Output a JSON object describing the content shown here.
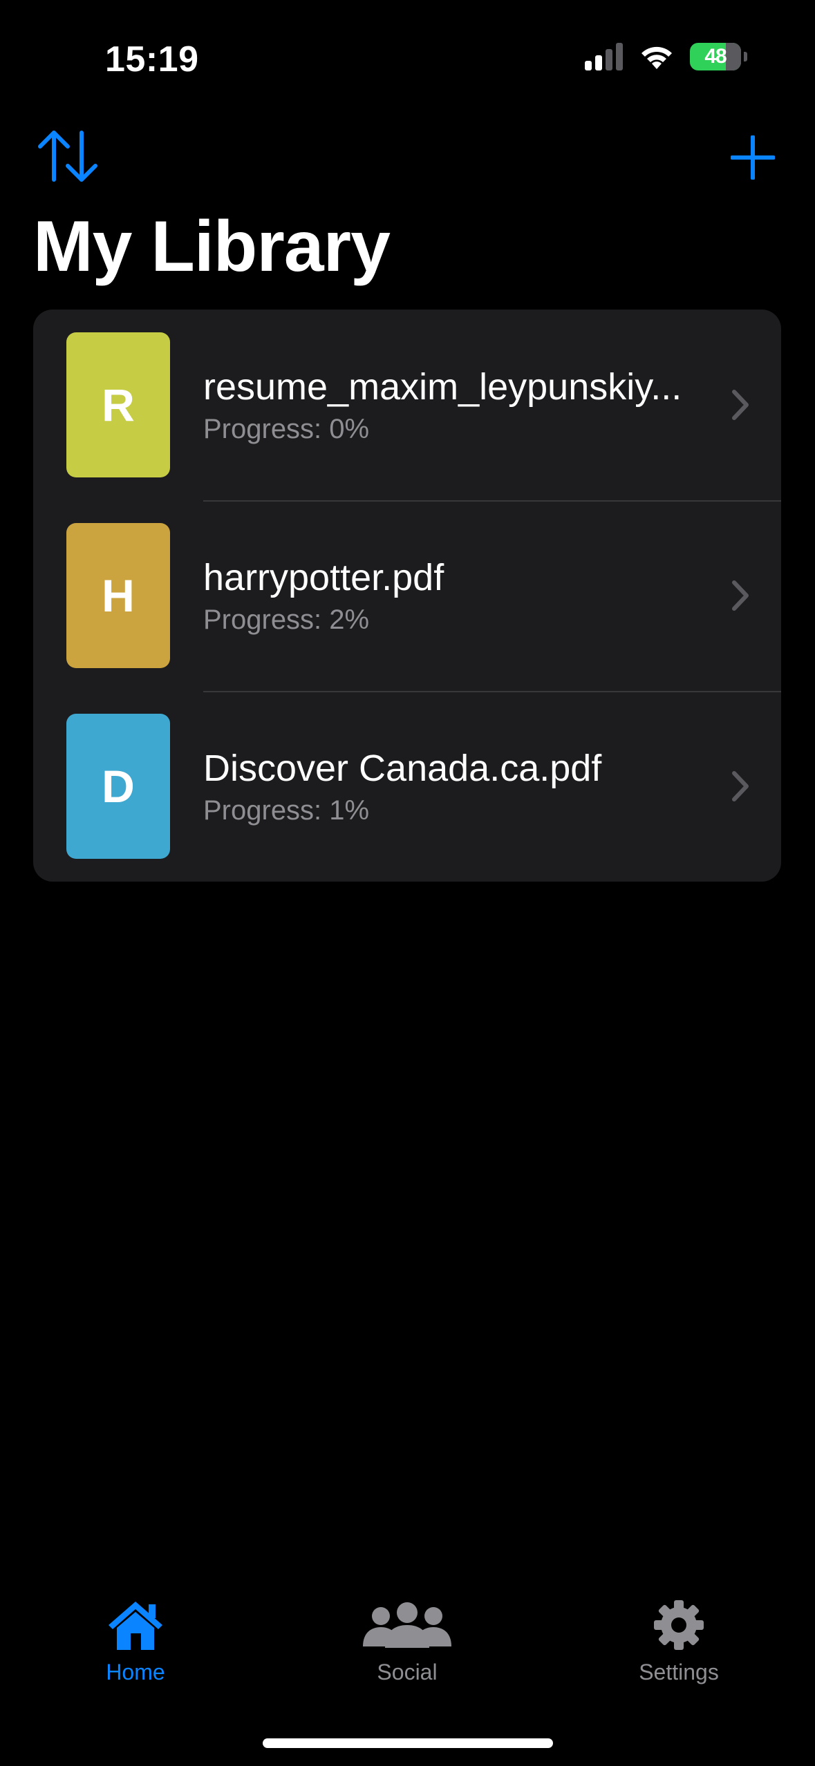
{
  "status_bar": {
    "time": "15:19",
    "battery_percent": "48",
    "icons": [
      "cellular-signal-icon",
      "wifi-icon",
      "battery-charging-icon"
    ]
  },
  "nav": {
    "sort_icon": "sort-arrows-icon",
    "add_icon": "plus-icon",
    "title": "My Library"
  },
  "colors": {
    "accent": "#0a84ff",
    "background": "#000000",
    "card": "#1c1c1e",
    "secondary_text": "#8e8e93"
  },
  "library": {
    "items": [
      {
        "initial": "R",
        "title": "resume_maxim_leypunskiy...",
        "progress": "Progress: 0%",
        "color": "#c6cc44"
      },
      {
        "initial": "H",
        "title": "harrypotter.pdf",
        "progress": "Progress: 2%",
        "color": "#cca43f"
      },
      {
        "initial": "D",
        "title": "Discover Canada.ca.pdf",
        "progress": "Progress: 1%",
        "color": "#3ea8d0"
      }
    ]
  },
  "tab_bar": {
    "tabs": [
      {
        "label": "Home",
        "icon": "house-icon",
        "active": true
      },
      {
        "label": "Social",
        "icon": "people-icon",
        "active": false
      },
      {
        "label": "Settings",
        "icon": "gear-icon",
        "active": false
      }
    ]
  }
}
